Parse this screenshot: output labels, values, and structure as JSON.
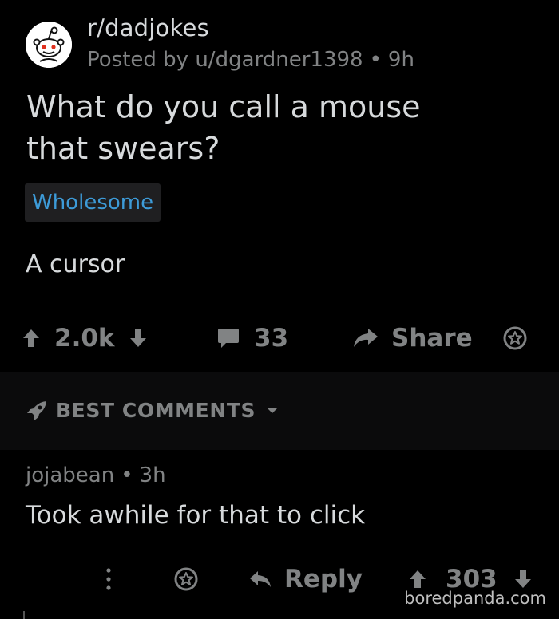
{
  "post": {
    "subreddit": "r/dadjokes",
    "posted_by_prefix": "Posted by",
    "author": "u/dgardner1398",
    "age": "9h",
    "title_line1": "What do you call a mouse",
    "title_line2": "that swears?",
    "flair": "Wholesome",
    "body": "A cursor",
    "votes": "2.0k",
    "comments_count": "33",
    "share_label": "Share"
  },
  "sort": {
    "label": "BEST COMMENTS"
  },
  "comment": {
    "author": "jojabean",
    "age": "3h",
    "text": "Took awhile for that to click",
    "reply_label": "Reply",
    "votes": "303"
  },
  "watermark": "boredpanda.com",
  "colors": {
    "background": "#000000",
    "text": "#d7dadc",
    "muted": "#818384",
    "flair_text": "#3d9bd8",
    "flair_bg": "#1f1f21",
    "sort_bar_bg": "#0b0b0c"
  },
  "icons": {
    "avatar": "reddit-snoo-avatar",
    "upvote": "up-arrow-icon",
    "downvote": "down-arrow-icon",
    "comments": "comment-bubble-icon",
    "share": "share-arrow-icon",
    "award": "award-icon",
    "sort": "rocket-icon",
    "sort_dropdown": "caret-down-icon",
    "more": "more-vertical-icon",
    "reply": "reply-arrow-icon"
  }
}
